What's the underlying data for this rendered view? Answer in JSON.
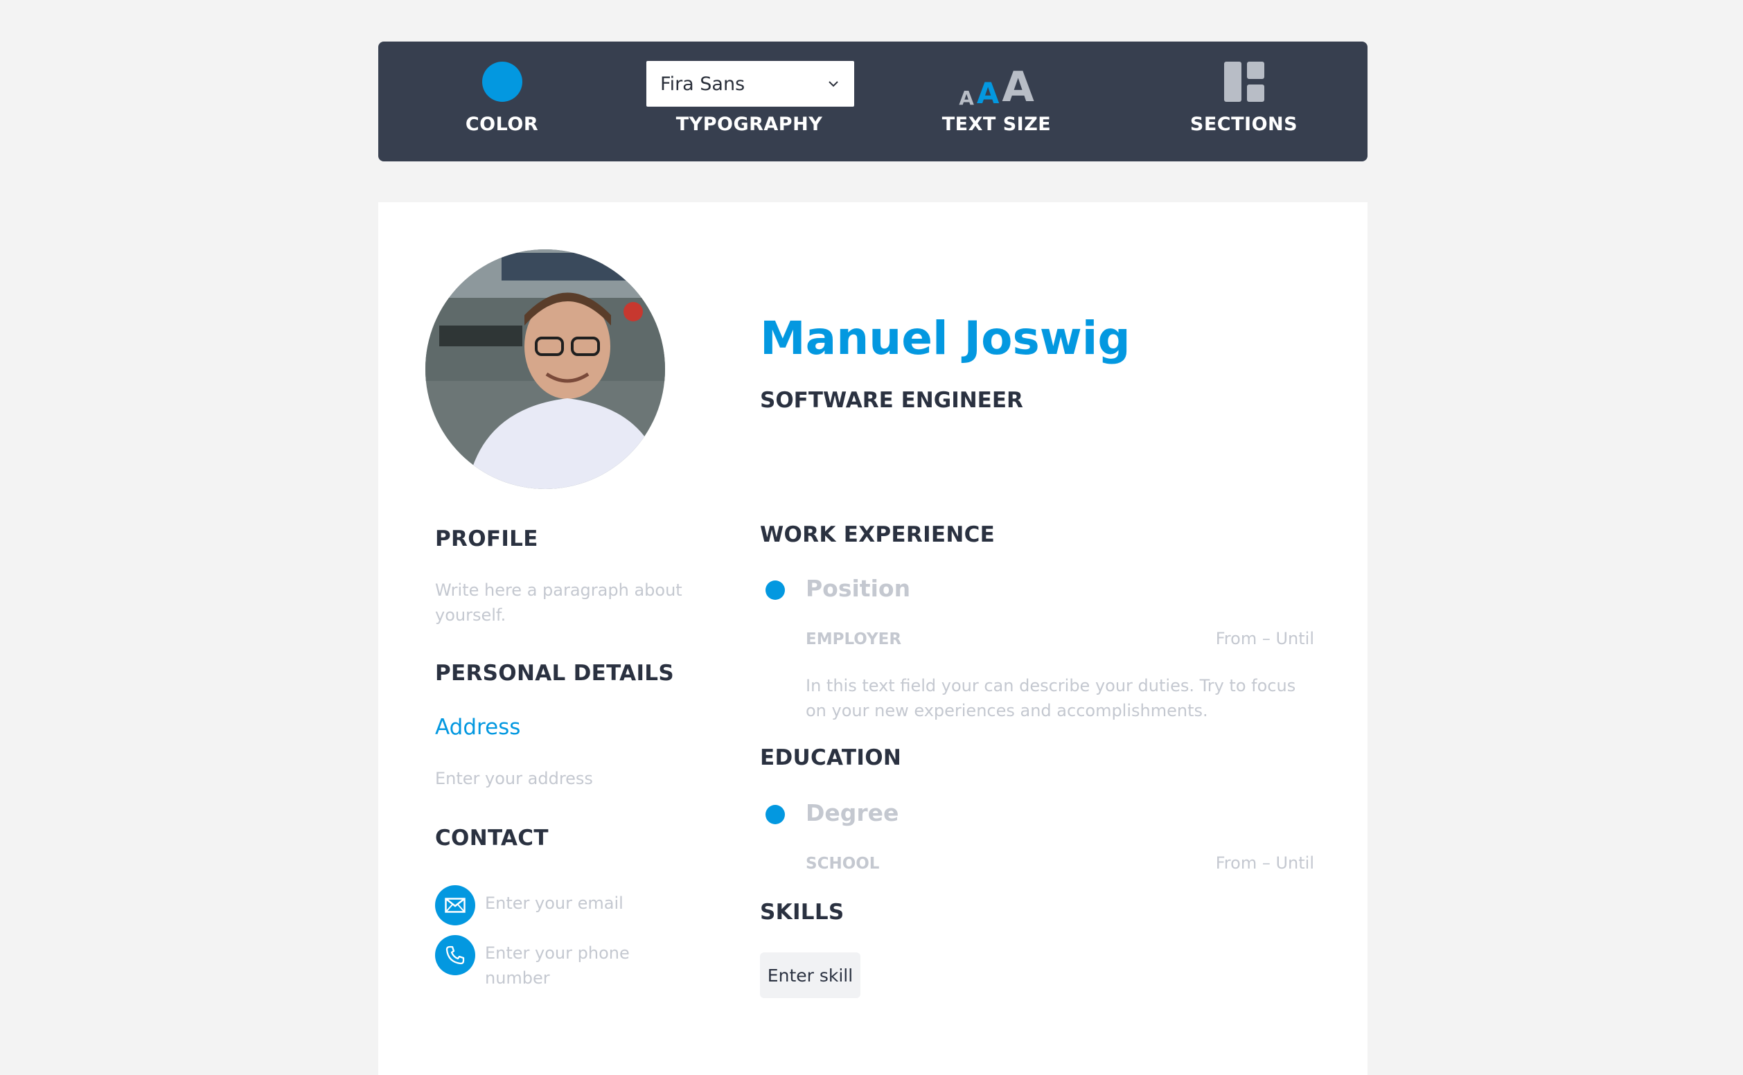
{
  "toolbar": {
    "color_label": "COLOR",
    "color_value": "#0398e0",
    "typography_label": "TYPOGRAPHY",
    "font_selected": "Fira Sans",
    "text_size_label": "TEXT SIZE",
    "text_size_glyphs": [
      "A",
      "A",
      "A"
    ],
    "sections_label": "SECTIONS"
  },
  "header": {
    "name": "Manuel Joswig",
    "title": "SOFTWARE ENGINEER"
  },
  "left": {
    "profile_title": "PROFILE",
    "profile_placeholder": "Write here a paragraph about yourself.",
    "personal_title": "PERSONAL DETAILS",
    "address_label": "Address",
    "address_placeholder": "Enter your address",
    "contact_title": "CONTACT",
    "email_placeholder": "Enter your email",
    "phone_placeholder": "Enter your phone number"
  },
  "work": {
    "title": "WORK EXPERIENCE",
    "position": "Position",
    "employer": "EMPLOYER",
    "dates": "From – Until",
    "description": "In this text field your can describe your duties. Try to focus on your new experiences and accomplishments."
  },
  "education": {
    "title": "EDUCATION",
    "degree": "Degree",
    "school": "SCHOOL",
    "dates": "From – Until"
  },
  "skills": {
    "title": "SKILLS",
    "chip": "Enter skill"
  }
}
